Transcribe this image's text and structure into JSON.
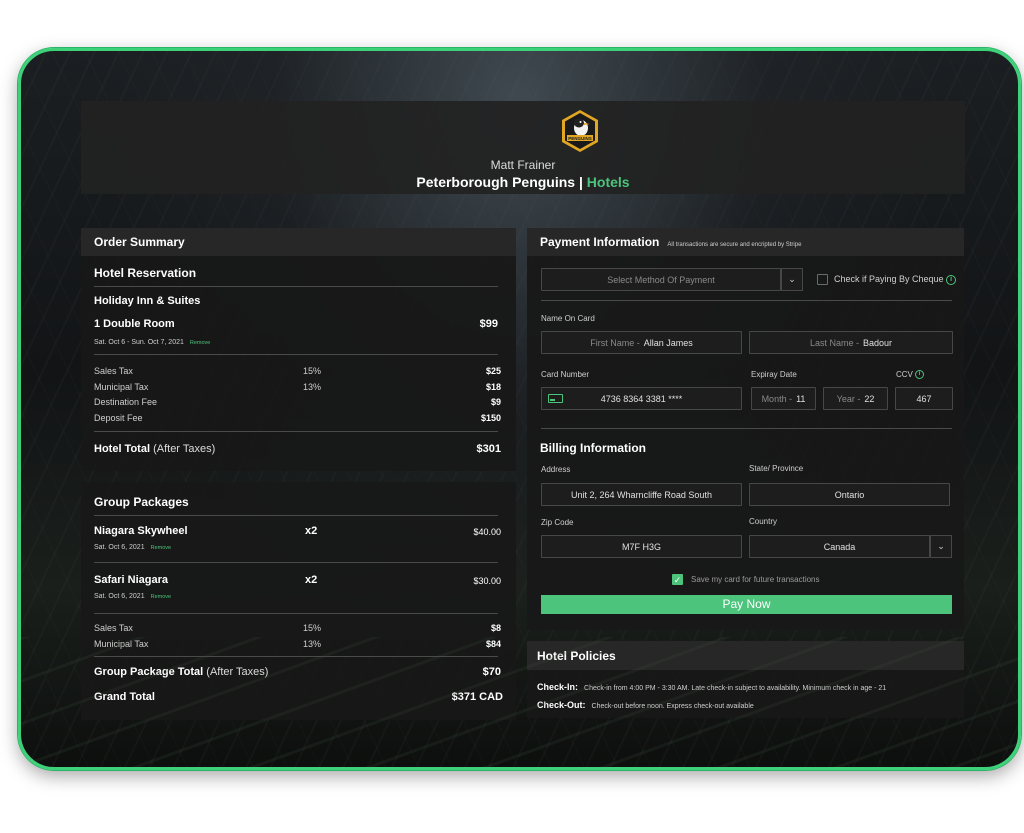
{
  "header": {
    "user_name": "Matt Frainer",
    "team_name": "Peterborough Penguins |",
    "section": "Hotels",
    "logo_text": "PENGUINS"
  },
  "order_summary": {
    "title": "Order Summary",
    "hotel_reservation_title": "Hotel Reservation",
    "hotel_name": "Holiday Inn & Suites",
    "room": "1 Double Room",
    "room_price": "$99",
    "dates": "Sat. Oct 6 - Sun. Oct 7, 2021",
    "remove_label": "Remove",
    "fees": [
      {
        "label": "Sales Tax",
        "rate": "15%",
        "amount": "$25"
      },
      {
        "label": "Municipal Tax",
        "rate": "13%",
        "amount": "$18"
      },
      {
        "label": "Destination Fee",
        "rate": "",
        "amount": "$9"
      },
      {
        "label": "Deposit Fee",
        "rate": "",
        "amount": "$150"
      }
    ],
    "total_label": "Hotel Total",
    "total_suffix": "(After Taxes)",
    "total_amount": "$301"
  },
  "group_packages": {
    "title": "Group Packages",
    "items": [
      {
        "name": "Niagara Skywheel",
        "qty": "x2",
        "date": "Sat. Oct 6, 2021",
        "price": "$40.00"
      },
      {
        "name": "Safari Niagara",
        "qty": "x2",
        "date": "Sat. Oct 6, 2021",
        "price": "$30.00"
      }
    ],
    "remove_label": "Remove",
    "fees": [
      {
        "label": "Sales Tax",
        "rate": "15%",
        "amount": "$8"
      },
      {
        "label": "Municipal Tax",
        "rate": "13%",
        "amount": "$84"
      }
    ],
    "total_label": "Group Package Total",
    "total_suffix": "(After Taxes)",
    "total_amount": "$70",
    "grand_total_label": "Grand Total",
    "grand_total_amount": "$371 CAD"
  },
  "payment": {
    "title": "Payment Information",
    "subtitle": "All transactions are secure and encripted by Stripe",
    "method_placeholder": "Select Method Of Payment",
    "cheque_label": "Check if Paying By Cheque",
    "name_on_card_label": "Name On Card",
    "first_name_placeholder": "First Name -",
    "first_name": "Allan James",
    "last_name_placeholder": "Last Name -",
    "last_name": "Badour",
    "card_number_label": "Card Number",
    "card_number": "4736 8364 3381 ****",
    "expiry_label": "Expiray Date",
    "month_placeholder": "Month -",
    "month": "11",
    "year_placeholder": "Year -",
    "year": "22",
    "ccv_label": "CCV",
    "ccv": "467",
    "billing_title": "Billing Information",
    "address_label": "Address",
    "address": "Unit 2, 264 Wharncliffe Road South",
    "province_label": "State/ Province",
    "province": "Ontario",
    "zip_label": "Zip Code",
    "zip": "M7F H3G",
    "country_label": "Country",
    "country": "Canada",
    "save_card_label": "Save my card for future transactions",
    "pay_button": "Pay Now"
  },
  "policies": {
    "title": "Hotel Policies",
    "checkin_label": "Check-In:",
    "checkin_text": "Check-in from 4:00 PM - 3:30 AM. Late check-in subject to availability. Minimum check in age - 21",
    "checkout_label": "Check-Out:",
    "checkout_text": "Check-out before noon. Express check-out available"
  },
  "colors": {
    "accent": "#4cc47c",
    "frame_border": "#3dd17a",
    "panel": "#181818"
  }
}
